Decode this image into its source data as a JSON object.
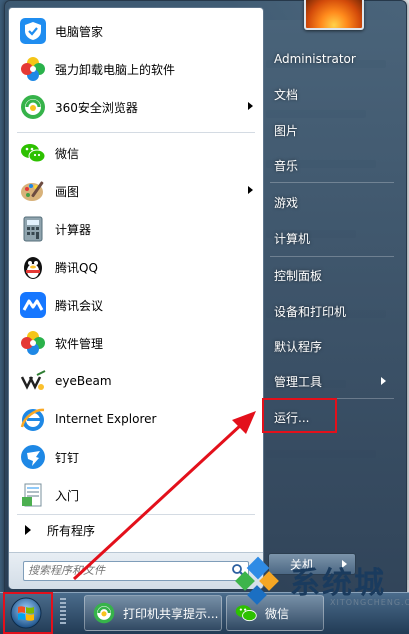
{
  "programs": [
    {
      "label": "电脑管家",
      "icon": "shield-check-icon"
    },
    {
      "label": "强力卸载电脑上的软件",
      "icon": "colorful-clover-icon"
    },
    {
      "label": "360安全浏览器",
      "icon": "360-browser-icon",
      "submenu": true
    },
    {
      "label": "微信",
      "icon": "wechat-icon"
    },
    {
      "label": "画图",
      "icon": "paint-palette-icon",
      "submenu": true
    },
    {
      "label": "计算器",
      "icon": "calculator-icon"
    },
    {
      "label": "腾讯QQ",
      "icon": "penguin-icon"
    },
    {
      "label": "腾讯会议",
      "icon": "meeting-icon"
    },
    {
      "label": "软件管理",
      "icon": "colorful-clover-icon"
    },
    {
      "label": "eyeBeam",
      "icon": "eyebeam-icon"
    },
    {
      "label": "Internet Explorer",
      "icon": "ie-icon"
    },
    {
      "label": "钉钉",
      "icon": "dingtalk-icon"
    },
    {
      "label": "入门",
      "icon": "getting-started-icon"
    }
  ],
  "all_programs": "所有程序",
  "search": {
    "placeholder": "搜索程序和文件"
  },
  "right_menu": [
    {
      "label": "Administrator"
    },
    {
      "label": "文档"
    },
    {
      "label": "图片"
    },
    {
      "label": "音乐"
    },
    {
      "label": "游戏"
    },
    {
      "label": "计算机"
    },
    {
      "label": "控制面板"
    },
    {
      "label": "设备和打印机"
    },
    {
      "label": "默认程序"
    },
    {
      "label": "管理工具",
      "submenu": true
    },
    {
      "label": "运行..."
    }
  ],
  "shutdown": {
    "label": "关机"
  },
  "taskbar": {
    "items": [
      {
        "label": "打印机共享提示...",
        "icon": "360-browser-icon"
      },
      {
        "label": "微信",
        "icon": "wechat-icon"
      }
    ]
  },
  "watermark": {
    "text": "系统城",
    "sub": "XITONGCHENG.COM"
  },
  "colors": {
    "highlight": "#e3101b",
    "menu_dark": "#34506b"
  }
}
